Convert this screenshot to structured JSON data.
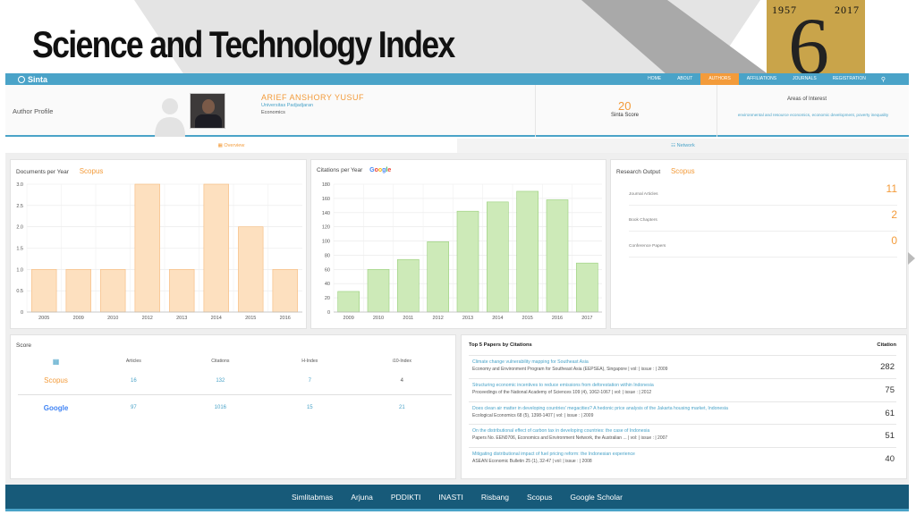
{
  "slide": {
    "title": "Science and Technology Index",
    "anniversary": {
      "year_start": "1957",
      "year_end": "2017",
      "digit": "6"
    }
  },
  "navbar": {
    "logo": "Sinta",
    "items": [
      "HOME",
      "ABOUT",
      "AUTHORS",
      "AFFILIATIONS",
      "JOURNALS",
      "REGISTRATION"
    ],
    "active": "AUTHORS",
    "search_icon": "search-icon"
  },
  "profile": {
    "label": "Author Profile",
    "name": "ARIEF ANSHORY YUSUF",
    "university": "Universitas Padjadjaran",
    "field": "Economics",
    "score": "20",
    "score_label": "Sinta Score",
    "interest_title": "Areas of Interest",
    "interests": "environmental and resource economics, economic development, poverty inequality"
  },
  "tabs": [
    {
      "label": "Overview",
      "icon": "bar-chart-icon"
    },
    {
      "label": "Network",
      "icon": "network-icon"
    }
  ],
  "documents_card": {
    "title": "Documents per Year",
    "brand": "Scopus"
  },
  "citations_card": {
    "title": "Citations per Year",
    "brand": "Google"
  },
  "chart_data": [
    {
      "type": "bar",
      "title": "Documents per Year",
      "categories": [
        "2005",
        "2009",
        "2010",
        "2012",
        "2013",
        "2014",
        "2015",
        "2016"
      ],
      "values": [
        1,
        1,
        1,
        3,
        1,
        3,
        2,
        1
      ],
      "ylim": [
        0,
        3.0
      ],
      "yticks": [
        "0",
        "0.5",
        "1.0",
        "1.5",
        "2.0",
        "2.5",
        "3.0"
      ],
      "color": "#fde0bf",
      "stroke": "#f6b97a",
      "grid": true
    },
    {
      "type": "bar",
      "title": "Citations per Year",
      "categories": [
        "2009",
        "2010",
        "2011",
        "2012",
        "2013",
        "2014",
        "2015",
        "2016",
        "2017"
      ],
      "values": [
        29,
        60,
        74,
        99,
        142,
        155,
        170,
        158,
        69
      ],
      "ylim": [
        0,
        180
      ],
      "yticks": [
        "0",
        "20",
        "40",
        "60",
        "80",
        "100",
        "120",
        "140",
        "160",
        "180"
      ],
      "color": "#cdeab8",
      "stroke": "#98cf7a",
      "grid": true
    }
  ],
  "research_output": {
    "title": "Research Output",
    "brand": "Scopus",
    "rows": [
      {
        "label": "Journal Articles",
        "value": "11"
      },
      {
        "label": "Book Chapters",
        "value": "2"
      },
      {
        "label": "Conference Papers",
        "value": "0"
      }
    ]
  },
  "score_card": {
    "title": "Score",
    "headers": [
      "Articles",
      "Citations",
      "H-Index",
      "i10-Index"
    ],
    "rows": [
      {
        "source": "Scopus",
        "articles": "16",
        "citations": "132",
        "h_index": "7",
        "i10_index": "4"
      },
      {
        "source": "Google",
        "articles": "97",
        "citations": "1016",
        "h_index": "15",
        "i10_index": "21"
      }
    ]
  },
  "top_papers": {
    "title": "Top 5 Papers by Citations",
    "citation_header": "Citation",
    "papers": [
      {
        "title": "Climate change vulnerability mapping for Southeast Asia",
        "source": "Economy and Environment Program for Southeast Asia (EEPSEA), Singapore | vol: | issue : | 2009",
        "citations": "282"
      },
      {
        "title": "Structuring economic incentives to reduce emissions from deforestation within Indonesia",
        "source": "Proceedings of the National Academy of Sciences 109 (4), 1062-1067 | vol: | issue : | 2012",
        "citations": "75"
      },
      {
        "title": "Does clean air matter in developing countries' megacities? A hedonic price analysis of the Jakarta housing market, Indonesia",
        "source": "Ecological Economics 68 (5), 1398-1407 | vol: | issue : | 2009",
        "citations": "61"
      },
      {
        "title": "On the distributional effect of carbon tax in developing countries: the case of Indonesia",
        "source": "Papers No. EEN0706, Economics and Environment Network, the Australian ... | vol: | issue : | 2007",
        "citations": "51"
      },
      {
        "title": "Mitigating distributional impact of fuel pricing reform: the Indonesian experience",
        "source": "ASEAN Economic Bulletin 25 (1), 32-47 | vol: | issue : | 2008",
        "citations": "40"
      }
    ]
  },
  "footer": {
    "links": [
      "Simlitabmas",
      "Arjuna",
      "PDDIKTI",
      "INASTI",
      "Risbang",
      "Scopus",
      "Google Scholar"
    ]
  }
}
